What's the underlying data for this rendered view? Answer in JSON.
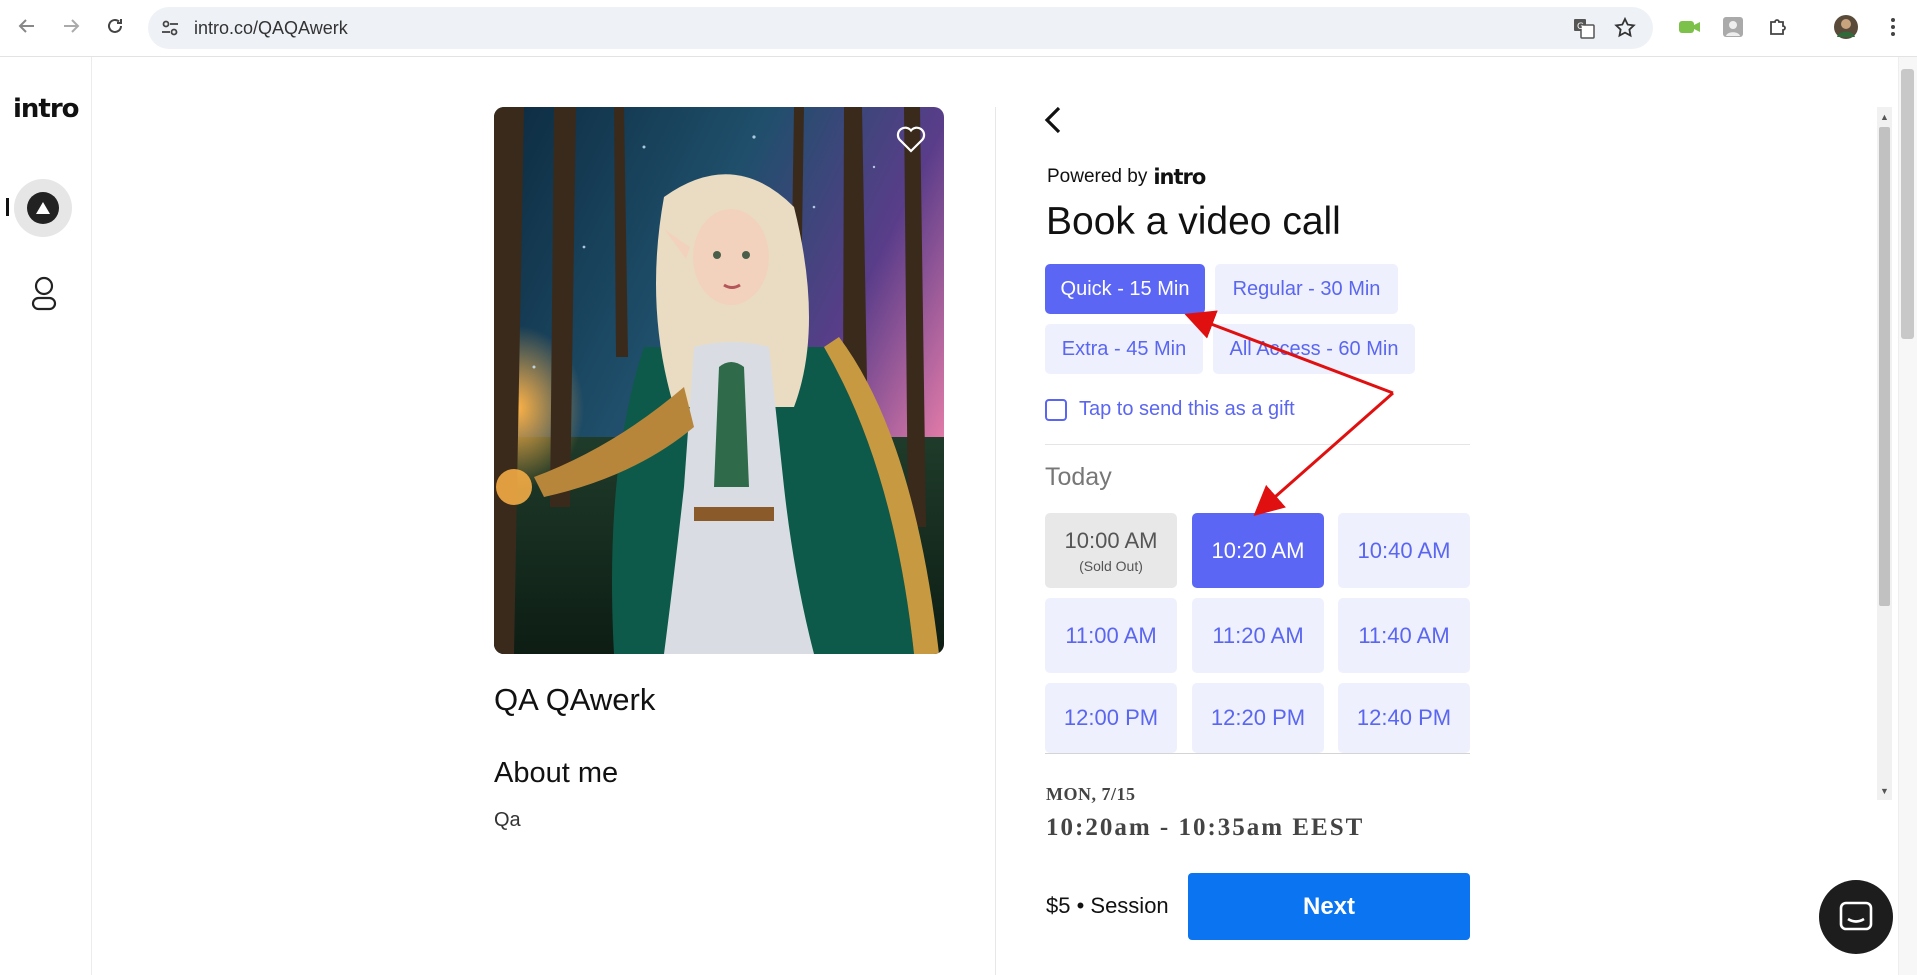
{
  "browser": {
    "url": "intro.co/QAQAwerk"
  },
  "rail": {
    "logo": "intro"
  },
  "profile": {
    "name": "QA QAwerk",
    "about_title": "About me",
    "about_text": "Qa"
  },
  "booking": {
    "powered_by": "Powered by",
    "brand": "intro",
    "title": "Book a video call",
    "durations": [
      {
        "label": "Quick - 15 Min",
        "selected": true
      },
      {
        "label": "Regular - 30 Min",
        "selected": false
      },
      {
        "label": "Extra - 45 Min",
        "selected": false
      },
      {
        "label": "All Access - 60 Min",
        "selected": false
      }
    ],
    "gift_label": "Tap to send this as a gift",
    "day_label": "Today",
    "slots": [
      {
        "time": "10:00 AM",
        "note": "(Sold Out)",
        "state": "sold"
      },
      {
        "time": "10:20 AM",
        "note": "",
        "state": "selected"
      },
      {
        "time": "10:40 AM",
        "note": "",
        "state": "available"
      },
      {
        "time": "11:00 AM",
        "note": "",
        "state": "available"
      },
      {
        "time": "11:20 AM",
        "note": "",
        "state": "available"
      },
      {
        "time": "11:40 AM",
        "note": "",
        "state": "available"
      },
      {
        "time": "12:00 PM",
        "note": "",
        "state": "available"
      },
      {
        "time": "12:20 PM",
        "note": "",
        "state": "available"
      },
      {
        "time": "12:40 PM",
        "note": "",
        "state": "available"
      }
    ],
    "selected_date": "MON, 7/15",
    "selected_range": "10:20am - 10:35am EEST",
    "price": "$5 • Session",
    "next_label": "Next"
  },
  "colors": {
    "accent": "#5c66f4",
    "accent_light": "#eef0fe",
    "primary_button": "#0b74f1",
    "annotation_arrow": "#e01010"
  }
}
